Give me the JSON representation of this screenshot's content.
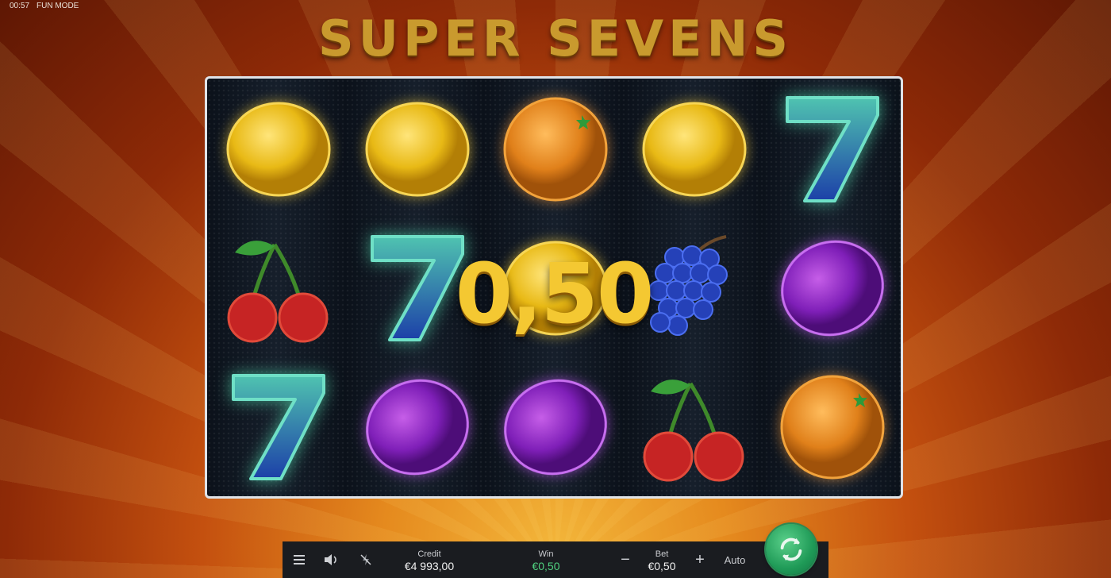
{
  "topbar": {
    "time": "00:57",
    "mode": "FUN MODE"
  },
  "game": {
    "title": "SUPER SEVENS"
  },
  "reels": {
    "grid": [
      [
        "lemon-icon",
        "lemon-icon",
        "orange-icon",
        "lemon-icon",
        "seven-icon"
      ],
      [
        "cherry-icon",
        "seven-icon",
        "lemon-icon",
        "grape-icon",
        "plum-icon"
      ],
      [
        "seven-icon",
        "plum-icon",
        "plum-icon",
        "cherry-icon",
        "orange-icon"
      ]
    ],
    "win_amount": "0,50"
  },
  "controls": {
    "menu_icon": "menu-icon",
    "sound_icon": "speaker-icon",
    "turbo_icon": "turbo-off-icon",
    "credit_label": "Credit",
    "credit_value": "€4 993,00",
    "win_label": "Win",
    "win_value": "€0,50",
    "bet_label": "Bet",
    "bet_value": "€0,50",
    "minus": "−",
    "plus": "+",
    "auto_label": "Auto",
    "spin_icon": "refresh-icon"
  },
  "colors": {
    "win_green": "#4fd17f",
    "title_gold": "#c99a2e",
    "spin_green": "#1f9a57"
  }
}
